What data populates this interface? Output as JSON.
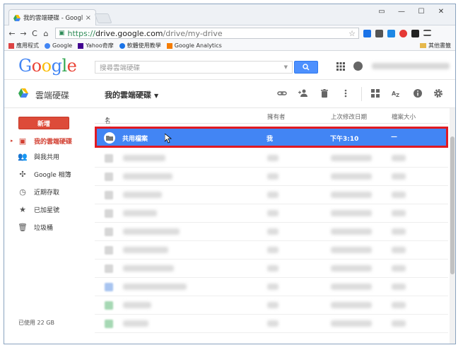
{
  "browser": {
    "tab_title": "我的雲端硬碟 - Google 雲",
    "tab_close": "×",
    "window_controls": [
      "▭",
      "—",
      "☐",
      "✕"
    ],
    "nav": {
      "back": "←",
      "forward": "→",
      "reload": "C",
      "home": "⌂"
    },
    "url": {
      "scheme": "https://",
      "host": "drive.google.com",
      "path": "/drive/my-drive"
    },
    "star": "☆"
  },
  "bookmarks": {
    "items": [
      {
        "label": "應用程式",
        "color": "#d44"
      },
      {
        "label": "Google",
        "color": "#4285f4"
      },
      {
        "label": "Yahoo奇摩",
        "color": "#400090"
      },
      {
        "label": "軟體使用教學",
        "color": "#1a73e8"
      },
      {
        "label": "Google Analytics",
        "color": "#f57c00"
      }
    ],
    "other": "其他書籤"
  },
  "google": {
    "logo": [
      "G",
      "o",
      "o",
      "g",
      "l",
      "e"
    ],
    "logo_colors": [
      "#4285f4",
      "#ea4335",
      "#fbbc05",
      "#4285f4",
      "#34a853",
      "#ea4335"
    ],
    "search_placeholder": "搜尋雲端硬碟",
    "search_dropdown": "▼"
  },
  "drive": {
    "title": "雲端硬碟",
    "breadcrumb": "我的雲端硬碟",
    "breadcrumb_caret": "▼",
    "toolbar_icons": [
      "link-icon",
      "add-person-icon",
      "trash-icon",
      "more-icon",
      "grid-view-icon",
      "sort-icon",
      "info-icon",
      "settings-icon"
    ]
  },
  "sidebar": {
    "new_label": "新增",
    "active_arrow": "▸",
    "items": [
      {
        "label": "我的雲端硬碟",
        "icon": "▣",
        "active": true
      },
      {
        "label": "與我共用",
        "icon": "👥"
      },
      {
        "label": "Google 相簿",
        "icon": "✣"
      },
      {
        "label": "近期存取",
        "icon": "◷"
      },
      {
        "label": "已加星號",
        "icon": "★"
      },
      {
        "label": "垃圾桶",
        "icon": "🗑"
      }
    ],
    "storage": "已使用 22 GB"
  },
  "list": {
    "columns": {
      "name": "名稱",
      "sort_arrow": "↑",
      "owner": "擁有者",
      "modified": "上次修改日期",
      "size": "檔案大小"
    },
    "selected": {
      "name": "共用檔案",
      "owner": "我",
      "modified": "下午3:10",
      "size": "—"
    }
  },
  "colors": {
    "accent": "#4285f4",
    "new_button": "#dd4b39",
    "highlight_border": "#e01a22"
  }
}
